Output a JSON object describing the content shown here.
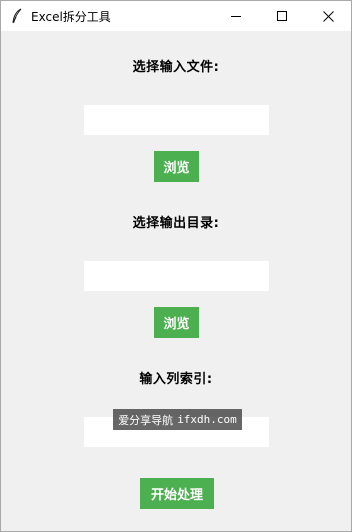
{
  "window": {
    "title": "Excel拆分工具",
    "icon": "feather-icon",
    "controls": [
      "minimize-icon",
      "maximize-icon",
      "close-icon"
    ]
  },
  "form": {
    "input_file_label": "选择输入文件:",
    "input_file_value": "",
    "input_browse_label": "浏览",
    "output_dir_label": "选择输出目录:",
    "output_dir_value": "",
    "output_browse_label": "浏览",
    "column_index_label": "输入列索引:",
    "column_index_value": "",
    "start_label": "开始处理"
  },
  "overlay": {
    "watermark_text": "爱分享导航",
    "watermark_domain": "ifxdh.com"
  },
  "colors": {
    "button": "#4caf50",
    "background": "#f0f0f0"
  }
}
